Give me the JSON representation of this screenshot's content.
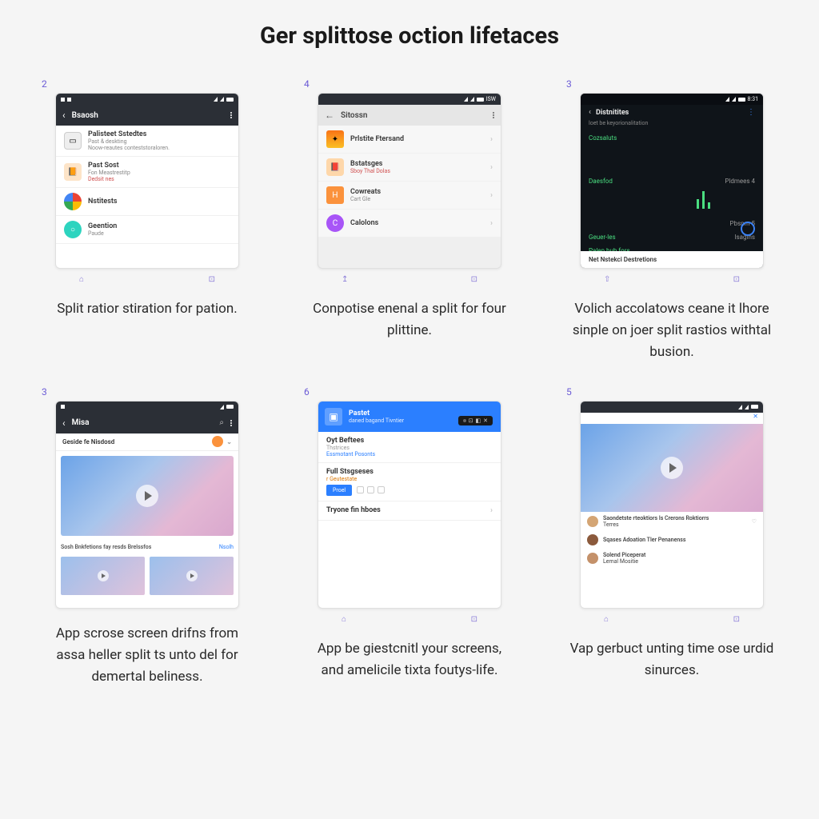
{
  "headline": "Ger splittose oction lifetaces",
  "cards": [
    {
      "step": "2",
      "appbar": "Bsaosh",
      "items": [
        {
          "title": "Palisteet Sstedtes",
          "sub": "Past & deskting",
          "sub2": "Noow-reautes conteststoraloren."
        },
        {
          "title": "Past Sost",
          "sub": "Fon Meastrestitp",
          "sub2": "Dedsit nes"
        },
        {
          "title": "Nstitests",
          "sub": ""
        },
        {
          "title": "Geention",
          "sub": "Paude"
        }
      ],
      "caption": "Split ratior stiration for pation."
    },
    {
      "step": "4",
      "appbar": "Sitossn",
      "items": [
        {
          "title": "Prlstite Ftersand",
          "sub": ""
        },
        {
          "title": "Bstatsges",
          "sub": "Sboy Thal Dolas"
        },
        {
          "title": "Cowreats",
          "sub": "Cart Gle"
        },
        {
          "title": "Calolons",
          "sub": ""
        }
      ],
      "caption": "Conpotise enenal a split for four plittine."
    },
    {
      "step": "3",
      "appbar": "Distnitites",
      "dark_sub": "loet be keyorionalitation",
      "rows": [
        {
          "k": "Cozsaluts",
          "v": ""
        },
        {
          "k": "Daesfod",
          "v": "Pldmees  4"
        },
        {
          "k": "",
          "v": "Pbsnm   5"
        },
        {
          "k": "Geuer-les",
          "v": "lsagins"
        },
        {
          "k": "Palep bub fors",
          "v": ""
        }
      ],
      "bottom": "Net Nstekci Destretions",
      "caption": "Volich accolatows ceane it lhore sinple on joer split rastios withtal busion."
    },
    {
      "step": "3",
      "appbar": "Misa",
      "subbar": "Geside fe Nisdosd",
      "rowtext": "Sosh Bnkfetions fay resds Brelssfos",
      "rowlink": "Nsolh",
      "caption": "App scrose screen drifns from assa heller split ts unto del for demertal beliness."
    },
    {
      "step": "6",
      "head_title": "Pastet",
      "head_sub": "daned bagand Tivntier",
      "sec1": "Oyt Beftees",
      "sec1_sub": "Thstrices",
      "sec1_sub2": "Essmotant Posonts",
      "sec2": "Full Stsgseses",
      "sec2_sub": "r Geutestate",
      "sec2_btn": "Proel",
      "sec3": "Tryone fin hboes",
      "caption": "App be giestcnitl your screens, and amelicile tixta foutys-life."
    },
    {
      "step": "5",
      "feed": [
        {
          "t": "Saondetste rteoktiors ls Crerons Roktiorrs",
          "s": "Terres"
        },
        {
          "t": "Sqases Adoation Tler Penanenss",
          "s": ""
        },
        {
          "t": "Solend Piceperat",
          "s": "Lemal Mositie"
        }
      ],
      "caption": "Vap gerbuct unting time ose urdid sinurces."
    }
  ]
}
